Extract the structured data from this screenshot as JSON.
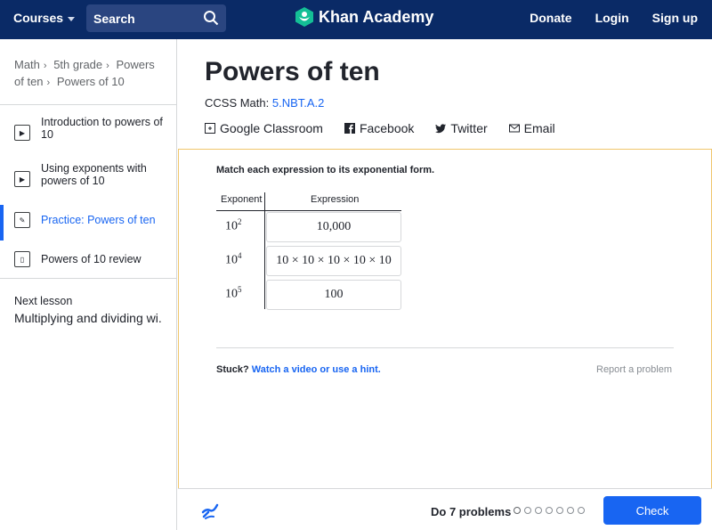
{
  "header": {
    "courses_label": "Courses",
    "search_placeholder": "Search",
    "brand": "Khan Academy",
    "donate": "Donate",
    "login": "Login",
    "signup": "Sign up",
    "bg_color": "#0a2a66"
  },
  "sidebar": {
    "breadcrumb": [
      "Math",
      "5th grade",
      "Powers of ten",
      "Powers of 10"
    ],
    "lessons": [
      {
        "label": "Introduction to powers of 10",
        "icon": "play-icon",
        "active": false
      },
      {
        "label": "Using exponents with powers of 10",
        "icon": "play-icon",
        "active": false
      },
      {
        "label": "Practice: Powers of ten",
        "icon": "pencil-icon",
        "active": true
      },
      {
        "label": "Powers of 10 review",
        "icon": "article-icon",
        "active": false
      }
    ],
    "next_label": "Next lesson",
    "next_title": "Multiplying and dividing wi..."
  },
  "main": {
    "title": "Powers of ten",
    "ccss_prefix": "CCSS Math: ",
    "ccss_code": "5.NBT.A.2",
    "share": {
      "google": "Google Classroom",
      "facebook": "Facebook",
      "twitter": "Twitter",
      "email": "Email"
    }
  },
  "exercise": {
    "prompt": "Match each expression to its exponential form.",
    "col_exponent": "Exponent",
    "col_expression": "Expression",
    "rows": [
      {
        "base": "10",
        "power": "2",
        "expression": "10,000"
      },
      {
        "base": "10",
        "power": "4",
        "expression": "10 × 10 × 10 × 10 × 10"
      },
      {
        "base": "10",
        "power": "5",
        "expression": "100"
      }
    ],
    "stuck": "Stuck?",
    "hint_link": "Watch a video or use a hint.",
    "report": "Report a problem"
  },
  "footer": {
    "do_problems": "Do 7 problems",
    "check": "Check",
    "accent": "#1865f2"
  }
}
